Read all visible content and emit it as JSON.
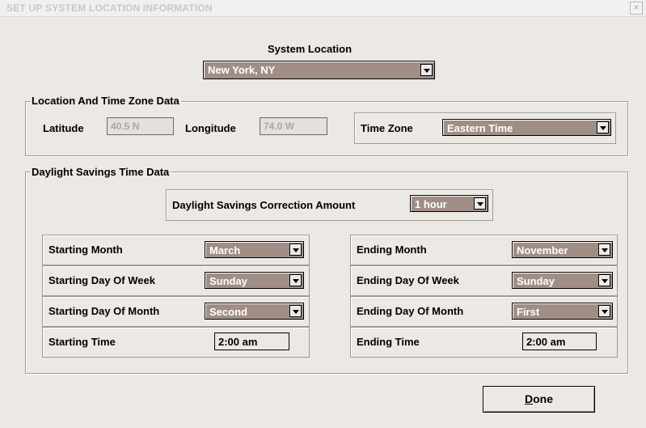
{
  "window": {
    "title": "SET UP SYSTEM LOCATION INFORMATION",
    "close_glyph": "×"
  },
  "system_location": {
    "label": "System Location",
    "value": "New York, NY"
  },
  "location_group": {
    "legend": "Location And Time Zone Data",
    "latitude_label": "Latitude",
    "latitude_value": "40.5 N",
    "longitude_label": "Longitude",
    "longitude_value": "74.0 W",
    "time_zone_label": "Time Zone",
    "time_zone_value": "Eastern Time"
  },
  "dst_group": {
    "legend": "Daylight Savings Time Data",
    "correction_label": "Daylight Savings Correction Amount",
    "correction_value": "1 hour",
    "start": {
      "month_label": "Starting Month",
      "month_value": "March",
      "dow_label": "Starting Day Of Week",
      "dow_value": "Sunday",
      "dom_label": "Starting Day Of Month",
      "dom_value": "Second",
      "time_label": "Starting Time",
      "time_value": "2:00 am"
    },
    "end": {
      "month_label": "Ending Month",
      "month_value": "November",
      "dow_label": "Ending Day Of Week",
      "dow_value": "Sunday",
      "dom_label": "Ending Day Of Month",
      "dom_value": "First",
      "time_label": "Ending Time",
      "time_value": "2:00 am"
    }
  },
  "done_button": {
    "mnemonic": "D",
    "rest": "one"
  },
  "colors": {
    "background": "#ece9e4",
    "combo_fill": "#a08e86"
  }
}
